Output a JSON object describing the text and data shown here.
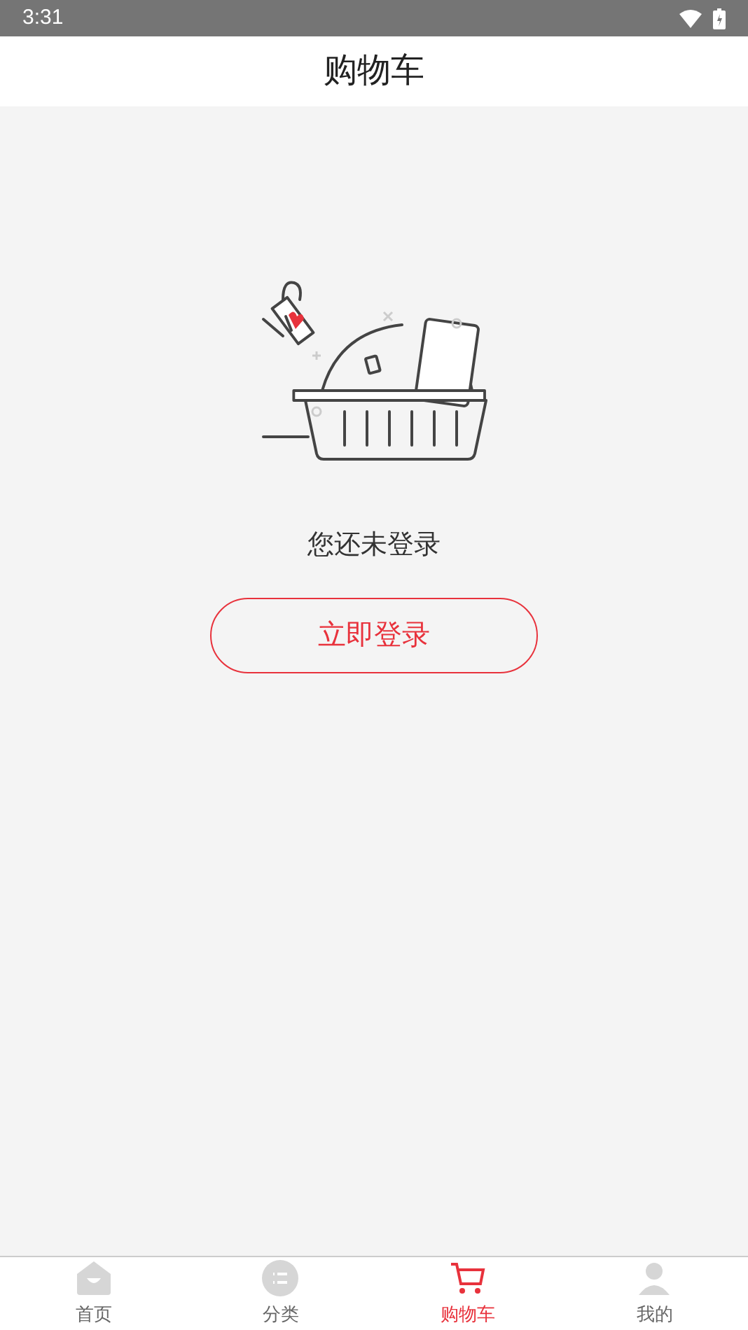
{
  "status_bar": {
    "time": "3:31"
  },
  "header": {
    "title": "购物车"
  },
  "empty_state": {
    "message": "您还未登录",
    "button": "立即登录"
  },
  "tabs": [
    {
      "kind": "home",
      "label": "首页",
      "selected": false
    },
    {
      "kind": "category",
      "label": "分类",
      "selected": false
    },
    {
      "kind": "cart",
      "label": "购物车",
      "selected": true
    },
    {
      "kind": "profile",
      "label": "我的",
      "selected": false
    }
  ]
}
